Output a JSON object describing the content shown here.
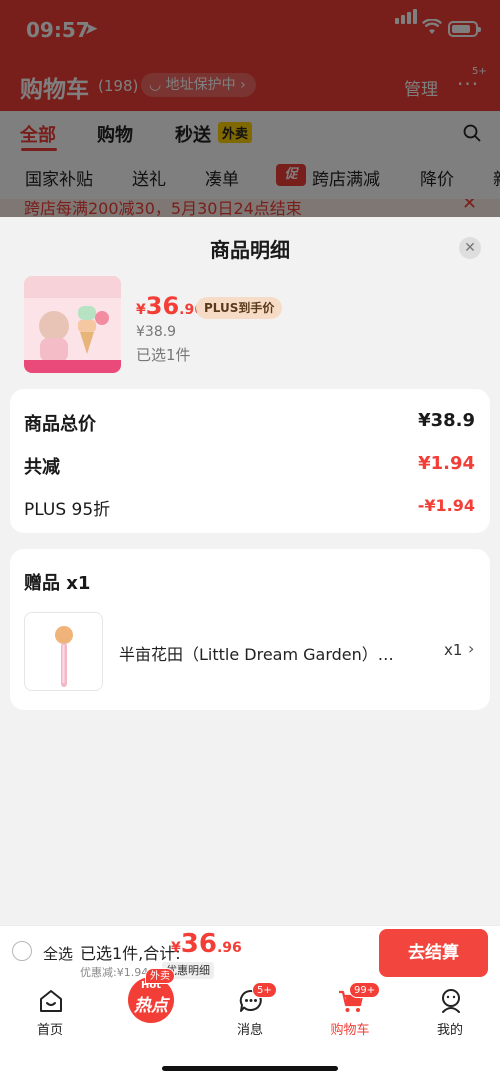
{
  "status_bar": {
    "time": "09:57"
  },
  "background_cart": {
    "title": "购物车",
    "count": "(198)",
    "address": "地址保护中",
    "manage": "管理",
    "more_badge": "5+",
    "tabs": [
      "全部",
      "购物",
      "秒送"
    ],
    "waimai_badge": "外卖",
    "filters": [
      "国家补贴",
      "送礼",
      "凑单",
      "跨店满减",
      "降价",
      "新"
    ],
    "promo_tag": "促",
    "notice": "跨店每满200减30，5月30日24点结束"
  },
  "sheet": {
    "title": "商品明细",
    "product": {
      "price_symbol": "¥",
      "price_int": "36",
      "price_dec": ".96",
      "plus_label": "PLUS到手价",
      "orig_price": "¥38.9",
      "selected": "已选1件"
    },
    "summary": [
      {
        "label": "商品总价",
        "value": "¥38.9",
        "style": "bold"
      },
      {
        "label": "共减",
        "value": "¥1.94",
        "style": "red"
      },
      {
        "label": "PLUS 95折",
        "value": "-¥1.94",
        "style": "red-small"
      }
    ],
    "gift": {
      "title": "赠品 x1",
      "name": "半亩花田（Little Dream Garden）…",
      "qty": "x1"
    }
  },
  "checkout": {
    "select_all": "全选",
    "summary_text": "已选1件,合计:",
    "price_symbol": "¥",
    "price_int": "36",
    "price_dec": ".96",
    "discount": "优惠减:¥1.94",
    "detail_label": "优惠明细",
    "button": "去结算"
  },
  "nav": {
    "items": [
      {
        "label": "首页"
      },
      {
        "label": "热点",
        "top_text": "Hot",
        "tag": "外卖"
      },
      {
        "label": "消息",
        "badge": "5+"
      },
      {
        "label": "购物车",
        "badge": "99+"
      },
      {
        "label": "我的"
      }
    ]
  },
  "colors": {
    "accent": "#f23e36",
    "plus_badge": "#f6dcc6"
  }
}
